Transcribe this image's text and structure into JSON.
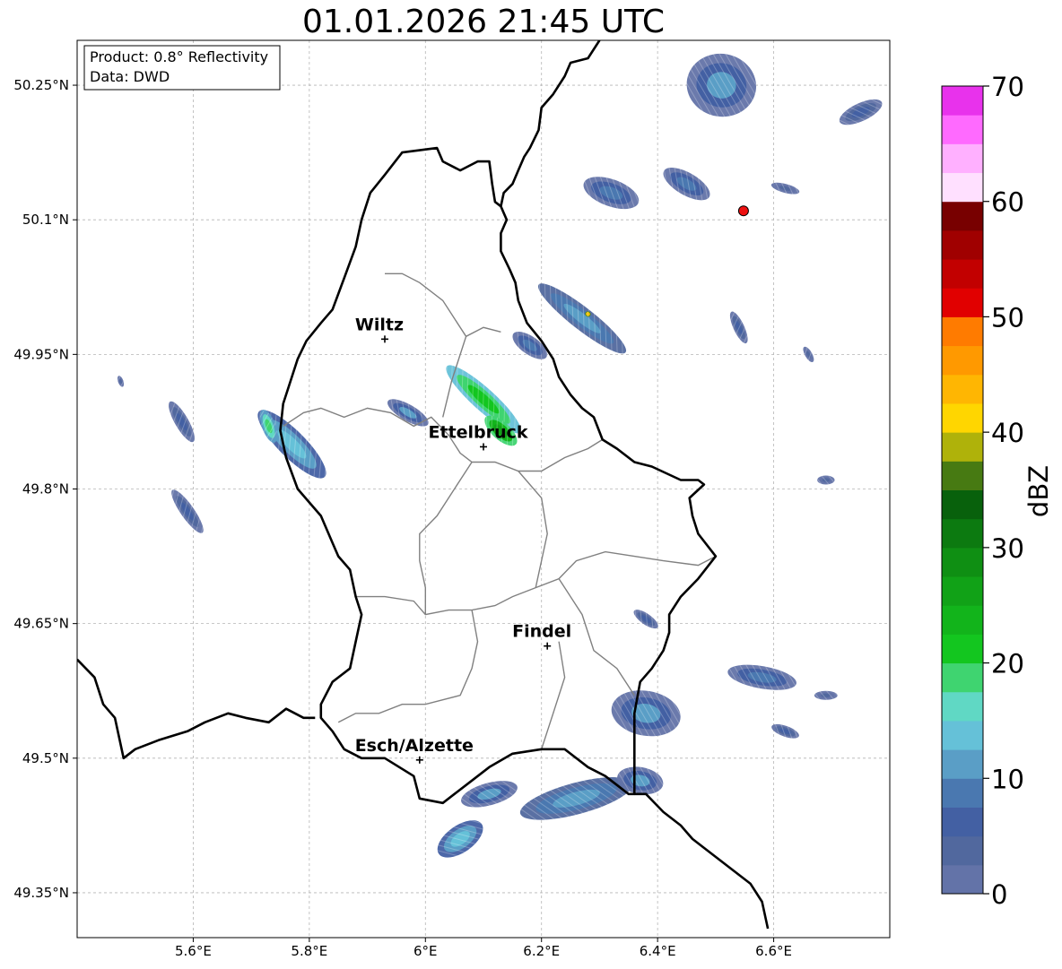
{
  "title": "01.01.2026 21:45 UTC",
  "info_box": {
    "line1": "Product: 0.8° Reflectivity",
    "line2": "Data: DWD"
  },
  "axes": {
    "lon_range": [
      5.4,
      6.8
    ],
    "lat_range": [
      49.3,
      50.3
    ],
    "x_ticks": [
      {
        "value": 5.6,
        "label": "5.6°E"
      },
      {
        "value": 5.8,
        "label": "5.8°E"
      },
      {
        "value": 6.0,
        "label": "6°E"
      },
      {
        "value": 6.2,
        "label": "6.2°E"
      },
      {
        "value": 6.4,
        "label": "6.4°E"
      },
      {
        "value": 6.6,
        "label": "6.6°E"
      }
    ],
    "y_ticks": [
      {
        "value": 50.25,
        "label": "50.25°N"
      },
      {
        "value": 50.1,
        "label": "50.1°N"
      },
      {
        "value": 49.95,
        "label": "49.95°N"
      },
      {
        "value": 49.8,
        "label": "49.8°N"
      },
      {
        "value": 49.65,
        "label": "49.65°N"
      },
      {
        "value": 49.5,
        "label": "49.5°N"
      },
      {
        "value": 49.35,
        "label": "49.35°N"
      }
    ]
  },
  "cities": [
    {
      "name": "Wiltz",
      "lon": 5.93,
      "lat": 49.967
    },
    {
      "name": "Ettelbruck",
      "lon": 6.1,
      "lat": 49.847
    },
    {
      "name": "Findel",
      "lon": 6.21,
      "lat": 49.625
    },
    {
      "name": "Esch/Alzette",
      "lon": 5.99,
      "lat": 49.498
    }
  ],
  "radar_site": {
    "lon": 6.548,
    "lat": 50.11,
    "color": "#ee1111"
  },
  "colorbar": {
    "label": "dBZ",
    "range": [
      0,
      70
    ],
    "tick_values": [
      0,
      10,
      20,
      30,
      40,
      50,
      60,
      70
    ],
    "tick_labels": [
      "0",
      "10",
      "20",
      "30",
      "40",
      "50",
      "60",
      "70"
    ],
    "colors": [
      "#6373a8",
      "#51689e",
      "#4360a3",
      "#4a78b0",
      "#5a9ec6",
      "#65c1d8",
      "#60d8c4",
      "#3fd470",
      "#13c61f",
      "#12b41b",
      "#11a217",
      "#0f8f13",
      "#0c7a10",
      "#08610c",
      "#477a12",
      "#afb20a",
      "#ffd600",
      "#ffb602",
      "#ff9900",
      "#ff7b00",
      "#e10000",
      "#c20000",
      "#a00000",
      "#780000",
      "#ffe0ff",
      "#ffb0ff",
      "#ff6aff",
      "#e832ec"
    ]
  },
  "echo_cells": [
    {
      "lon": 6.1,
      "lat": 49.9,
      "dbz": 22,
      "len": 0.17,
      "wid": 0.025,
      "angle": 42
    },
    {
      "lon": 6.13,
      "lat": 49.865,
      "dbz": 26,
      "len": 0.07,
      "wid": 0.02,
      "angle": 42
    },
    {
      "lon": 6.27,
      "lat": 49.99,
      "dbz": 12,
      "len": 0.19,
      "wid": 0.025,
      "angle": 38
    },
    {
      "lon": 6.28,
      "lat": 49.995,
      "dbz": 44,
      "len": 0.01,
      "wid": 0.006,
      "angle": 38
    },
    {
      "lon": 6.18,
      "lat": 49.96,
      "dbz": 8,
      "len": 0.07,
      "wid": 0.02,
      "angle": 35
    },
    {
      "lon": 5.97,
      "lat": 49.885,
      "dbz": 10,
      "len": 0.08,
      "wid": 0.018,
      "angle": 30
    },
    {
      "lon": 5.77,
      "lat": 49.85,
      "dbz": 14,
      "len": 0.16,
      "wid": 0.03,
      "angle": 45
    },
    {
      "lon": 5.73,
      "lat": 49.87,
      "dbz": 18,
      "len": 0.06,
      "wid": 0.015,
      "angle": 70
    },
    {
      "lon": 5.58,
      "lat": 49.875,
      "dbz": 6,
      "len": 0.08,
      "wid": 0.015,
      "angle": 60
    },
    {
      "lon": 5.59,
      "lat": 49.775,
      "dbz": 6,
      "len": 0.09,
      "wid": 0.015,
      "angle": 55
    },
    {
      "lon": 6.54,
      "lat": 49.98,
      "dbz": 6,
      "len": 0.06,
      "wid": 0.012,
      "angle": 65
    },
    {
      "lon": 6.66,
      "lat": 49.95,
      "dbz": 4,
      "len": 0.03,
      "wid": 0.008,
      "angle": 60
    },
    {
      "lon": 6.51,
      "lat": 50.25,
      "dbz": 10,
      "len": 0.12,
      "wid": 0.07,
      "angle": 10
    },
    {
      "lon": 6.32,
      "lat": 50.13,
      "dbz": 8,
      "len": 0.1,
      "wid": 0.03,
      "angle": 20
    },
    {
      "lon": 6.45,
      "lat": 50.14,
      "dbz": 8,
      "len": 0.09,
      "wid": 0.025,
      "angle": 30
    },
    {
      "lon": 6.75,
      "lat": 50.22,
      "dbz": 6,
      "len": 0.08,
      "wid": 0.02,
      "angle": -25
    },
    {
      "lon": 6.62,
      "lat": 50.135,
      "dbz": 4,
      "len": 0.05,
      "wid": 0.01,
      "angle": 15
    },
    {
      "lon": 6.38,
      "lat": 49.55,
      "dbz": 10,
      "len": 0.12,
      "wid": 0.05,
      "angle": 10
    },
    {
      "lon": 6.58,
      "lat": 49.59,
      "dbz": 8,
      "len": 0.12,
      "wid": 0.025,
      "angle": 10
    },
    {
      "lon": 6.38,
      "lat": 49.655,
      "dbz": 6,
      "len": 0.05,
      "wid": 0.012,
      "angle": 35
    },
    {
      "lon": 6.26,
      "lat": 49.455,
      "dbz": 12,
      "len": 0.2,
      "wid": 0.035,
      "angle": -15
    },
    {
      "lon": 6.37,
      "lat": 49.475,
      "dbz": 10,
      "len": 0.08,
      "wid": 0.03,
      "angle": 10
    },
    {
      "lon": 6.06,
      "lat": 49.41,
      "dbz": 14,
      "len": 0.09,
      "wid": 0.03,
      "angle": -35
    },
    {
      "lon": 6.11,
      "lat": 49.46,
      "dbz": 10,
      "len": 0.1,
      "wid": 0.025,
      "angle": -15
    },
    {
      "lon": 6.62,
      "lat": 49.53,
      "dbz": 6,
      "len": 0.05,
      "wid": 0.012,
      "angle": 20
    },
    {
      "lon": 6.69,
      "lat": 49.57,
      "dbz": 4,
      "len": 0.04,
      "wid": 0.01,
      "angle": 0
    },
    {
      "lon": 6.69,
      "lat": 49.81,
      "dbz": 4,
      "len": 0.03,
      "wid": 0.01,
      "angle": 0
    },
    {
      "lon": 5.475,
      "lat": 49.92,
      "dbz": 4,
      "len": 0.02,
      "wid": 0.006,
      "angle": 70
    }
  ],
  "country_border": [
    [
      6.3,
      50.3
    ],
    [
      6.28,
      50.28
    ],
    [
      6.25,
      50.275
    ],
    [
      6.24,
      50.26
    ],
    [
      6.22,
      50.24
    ],
    [
      6.2,
      50.225
    ],
    [
      6.195,
      50.2
    ],
    [
      6.18,
      50.18
    ],
    [
      6.17,
      50.17
    ],
    [
      6.16,
      50.155
    ],
    [
      6.15,
      50.14
    ],
    [
      6.135,
      50.13
    ],
    [
      6.13,
      50.115
    ],
    [
      6.14,
      50.1
    ],
    [
      6.13,
      50.085
    ],
    [
      6.13,
      50.065
    ],
    [
      6.145,
      50.045
    ],
    [
      6.155,
      50.03
    ],
    [
      6.16,
      50.01
    ],
    [
      6.175,
      49.985
    ],
    [
      6.2,
      49.965
    ],
    [
      6.22,
      49.945
    ],
    [
      6.23,
      49.925
    ],
    [
      6.25,
      49.905
    ],
    [
      6.27,
      49.89
    ],
    [
      6.29,
      49.88
    ],
    [
      6.305,
      49.855
    ],
    [
      6.33,
      49.845
    ],
    [
      6.36,
      49.83
    ],
    [
      6.39,
      49.825
    ],
    [
      6.44,
      49.81
    ],
    [
      6.47,
      49.81
    ],
    [
      6.48,
      49.805
    ],
    [
      6.455,
      49.79
    ],
    [
      6.46,
      49.77
    ],
    [
      6.47,
      49.75
    ],
    [
      6.5,
      49.725
    ],
    [
      6.47,
      49.7
    ],
    [
      6.44,
      49.68
    ],
    [
      6.42,
      49.66
    ],
    [
      6.42,
      49.64
    ],
    [
      6.41,
      49.62
    ],
    [
      6.39,
      49.6
    ],
    [
      6.37,
      49.585
    ],
    [
      6.36,
      49.55
    ],
    [
      6.36,
      49.51
    ],
    [
      6.36,
      49.46
    ],
    [
      6.35,
      49.46
    ],
    [
      6.31,
      49.48
    ],
    [
      6.28,
      49.49
    ],
    [
      6.24,
      49.51
    ],
    [
      6.2,
      49.51
    ],
    [
      6.15,
      49.505
    ],
    [
      6.11,
      49.49
    ],
    [
      6.08,
      49.475
    ],
    [
      6.05,
      49.46
    ],
    [
      6.03,
      49.45
    ],
    [
      5.99,
      49.455
    ],
    [
      5.98,
      49.48
    ],
    [
      5.93,
      49.5
    ],
    [
      5.89,
      49.5
    ],
    [
      5.86,
      49.51
    ],
    [
      5.84,
      49.53
    ],
    [
      5.82,
      49.545
    ],
    [
      5.82,
      49.56
    ],
    [
      5.84,
      49.585
    ],
    [
      5.87,
      49.6
    ],
    [
      5.88,
      49.63
    ],
    [
      5.89,
      49.66
    ],
    [
      5.88,
      49.68
    ],
    [
      5.87,
      49.71
    ],
    [
      5.85,
      49.725
    ],
    [
      5.84,
      49.74
    ],
    [
      5.82,
      49.77
    ],
    [
      5.78,
      49.8
    ],
    [
      5.76,
      49.835
    ],
    [
      5.75,
      49.865
    ],
    [
      5.755,
      49.895
    ],
    [
      5.765,
      49.915
    ],
    [
      5.78,
      49.945
    ],
    [
      5.795,
      49.965
    ],
    [
      5.82,
      49.985
    ],
    [
      5.84,
      50.0
    ],
    [
      5.86,
      50.035
    ],
    [
      5.88,
      50.07
    ],
    [
      5.89,
      50.1
    ],
    [
      5.905,
      50.13
    ],
    [
      5.93,
      50.15
    ],
    [
      5.96,
      50.175
    ],
    [
      6.02,
      50.18
    ],
    [
      6.03,
      50.165
    ],
    [
      6.06,
      50.155
    ],
    [
      6.09,
      50.165
    ],
    [
      6.11,
      50.165
    ],
    [
      6.115,
      50.14
    ],
    [
      6.12,
      50.12
    ],
    [
      6.13,
      50.115
    ]
  ],
  "border_be_fr": [
    [
      5.4,
      49.61
    ],
    [
      5.43,
      49.59
    ],
    [
      5.445,
      49.56
    ],
    [
      5.465,
      49.545
    ],
    [
      5.48,
      49.5
    ],
    [
      5.5,
      49.51
    ],
    [
      5.54,
      49.52
    ],
    [
      5.59,
      49.53
    ],
    [
      5.62,
      49.54
    ],
    [
      5.66,
      49.55
    ],
    [
      5.69,
      49.545
    ],
    [
      5.73,
      49.54
    ],
    [
      5.76,
      49.555
    ],
    [
      5.79,
      49.545
    ],
    [
      5.81,
      49.545
    ]
  ],
  "border_de_fr": [
    [
      6.36,
      49.46
    ],
    [
      6.38,
      49.46
    ],
    [
      6.41,
      49.44
    ],
    [
      6.44,
      49.425
    ],
    [
      6.46,
      49.41
    ],
    [
      6.48,
      49.4
    ],
    [
      6.52,
      49.38
    ],
    [
      6.56,
      49.36
    ],
    [
      6.58,
      49.34
    ],
    [
      6.59,
      49.31
    ]
  ],
  "cantons": [
    [
      [
        5.93,
        50.04
      ],
      [
        5.96,
        50.04
      ],
      [
        5.99,
        50.03
      ],
      [
        6.03,
        50.01
      ],
      [
        6.05,
        49.99
      ],
      [
        6.07,
        49.97
      ],
      [
        6.1,
        49.98
      ],
      [
        6.13,
        49.975
      ]
    ],
    [
      [
        5.755,
        49.87
      ],
      [
        5.79,
        49.885
      ],
      [
        5.82,
        49.89
      ],
      [
        5.86,
        49.88
      ],
      [
        5.9,
        49.89
      ],
      [
        5.94,
        49.885
      ],
      [
        5.98,
        49.87
      ],
      [
        6.01,
        49.88
      ],
      [
        6.04,
        49.86
      ],
      [
        6.06,
        49.84
      ],
      [
        6.08,
        49.83
      ],
      [
        6.12,
        49.83
      ],
      [
        6.16,
        49.82
      ],
      [
        6.2,
        49.82
      ],
      [
        6.24,
        49.835
      ],
      [
        6.28,
        49.845
      ],
      [
        6.305,
        49.855
      ]
    ],
    [
      [
        6.07,
        49.97
      ],
      [
        6.045,
        49.92
      ],
      [
        6.03,
        49.88
      ]
    ],
    [
      [
        6.08,
        49.83
      ],
      [
        6.05,
        49.8
      ],
      [
        6.02,
        49.77
      ],
      [
        5.99,
        49.75
      ],
      [
        5.99,
        49.72
      ],
      [
        6.0,
        49.69
      ],
      [
        6.0,
        49.66
      ]
    ],
    [
      [
        6.16,
        49.82
      ],
      [
        6.2,
        49.79
      ],
      [
        6.21,
        49.75
      ],
      [
        6.2,
        49.72
      ],
      [
        6.19,
        49.69
      ]
    ],
    [
      [
        5.88,
        49.68
      ],
      [
        5.93,
        49.68
      ],
      [
        5.98,
        49.675
      ],
      [
        6.0,
        49.66
      ],
      [
        6.04,
        49.665
      ],
      [
        6.08,
        49.665
      ],
      [
        6.12,
        49.67
      ],
      [
        6.15,
        49.68
      ],
      [
        6.19,
        49.69
      ],
      [
        6.23,
        49.7
      ],
      [
        6.26,
        49.72
      ],
      [
        6.31,
        49.73
      ],
      [
        6.36,
        49.725
      ],
      [
        6.41,
        49.72
      ],
      [
        6.47,
        49.715
      ],
      [
        6.5,
        49.725
      ]
    ],
    [
      [
        6.08,
        49.665
      ],
      [
        6.09,
        49.63
      ],
      [
        6.08,
        49.6
      ],
      [
        6.06,
        49.57
      ],
      [
        6.0,
        49.56
      ],
      [
        5.96,
        49.56
      ],
      [
        5.92,
        49.55
      ],
      [
        5.88,
        49.55
      ],
      [
        5.85,
        49.54
      ]
    ],
    [
      [
        6.23,
        49.7
      ],
      [
        6.27,
        49.66
      ],
      [
        6.29,
        49.62
      ],
      [
        6.33,
        49.6
      ],
      [
        6.36,
        49.57
      ]
    ],
    [
      [
        6.2,
        49.51
      ],
      [
        6.22,
        49.55
      ],
      [
        6.24,
        49.59
      ],
      [
        6.23,
        49.63
      ]
    ]
  ]
}
